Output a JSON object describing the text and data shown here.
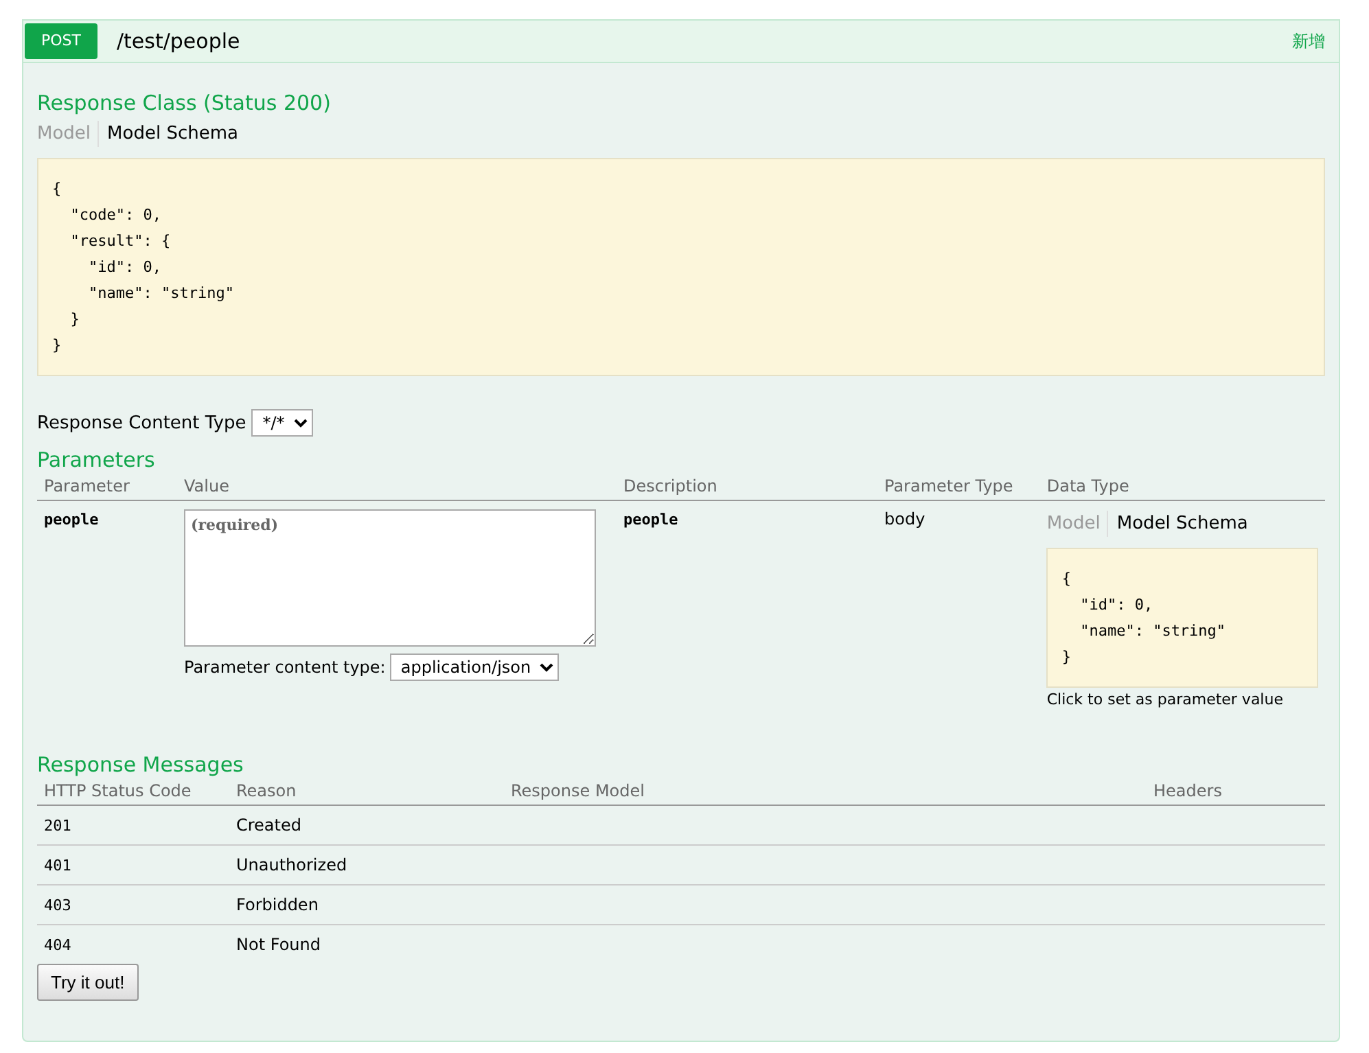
{
  "operation": {
    "method": "POST",
    "path": "/test/people",
    "summary": "新增"
  },
  "response_class": {
    "title": "Response Class (Status 200)",
    "tabs": [
      {
        "label": "Model",
        "selected": false
      },
      {
        "label": "Model Schema",
        "selected": true
      }
    ],
    "schema": "{\n  \"code\": 0,\n  \"result\": {\n    \"id\": 0,\n    \"name\": \"string\"\n  }\n}"
  },
  "response_content_type": {
    "label": "Response Content Type",
    "value": "*/*"
  },
  "parameters": {
    "title": "Parameters",
    "columns": [
      "Parameter",
      "Value",
      "Description",
      "Parameter Type",
      "Data Type"
    ],
    "rows": [
      {
        "name": "people",
        "placeholder": "(required)",
        "content_type_label": "Parameter content type:",
        "content_type": "application/json",
        "description": "people",
        "type": "body",
        "tabs": [
          {
            "label": "Model",
            "selected": false
          },
          {
            "label": "Model Schema",
            "selected": true
          }
        ],
        "schema": "{\n  \"id\": 0,\n  \"name\": \"string\"\n}",
        "hint": "Click to set as parameter value"
      }
    ]
  },
  "response_messages": {
    "title": "Response Messages",
    "columns": [
      "HTTP Status Code",
      "Reason",
      "Response Model",
      "Headers"
    ],
    "rows": [
      {
        "code": "201",
        "reason": "Created"
      },
      {
        "code": "401",
        "reason": "Unauthorized"
      },
      {
        "code": "403",
        "reason": "Forbidden"
      },
      {
        "code": "404",
        "reason": "Not Found"
      }
    ]
  },
  "try_button": "Try it out!"
}
